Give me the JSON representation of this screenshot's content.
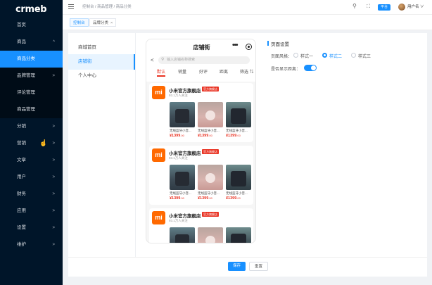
{
  "logo": "crmeb",
  "sidebar": {
    "items": [
      {
        "label": "首页",
        "arrow": ""
      },
      {
        "label": "商品",
        "arrow": "^"
      },
      {
        "label": "商品分类",
        "arrow": ""
      },
      {
        "label": "品牌管理",
        "arrow": ">"
      },
      {
        "label": "评论管理",
        "arrow": ""
      },
      {
        "label": "商品管理",
        "arrow": ""
      },
      {
        "label": "分销",
        "arrow": ">"
      },
      {
        "label": "营销",
        "arrow": ">"
      },
      {
        "label": "文章",
        "arrow": ">"
      },
      {
        "label": "用户",
        "arrow": ">"
      },
      {
        "label": "财务",
        "arrow": ">"
      },
      {
        "label": "应用",
        "arrow": ">"
      },
      {
        "label": "设置",
        "arrow": ">"
      },
      {
        "label": "维护",
        "arrow": ">"
      }
    ]
  },
  "header": {
    "breadcrumb": "控制台 / 商品管理 / 商品分类",
    "badge": "平台",
    "username": "用户名",
    "caret": "∨"
  },
  "tabs": [
    {
      "label": "控制台"
    },
    {
      "label": "品牌分类",
      "close": "×"
    }
  ],
  "page_menu": [
    {
      "label": "商城首页"
    },
    {
      "label": "店铺街"
    },
    {
      "label": "个人中心"
    }
  ],
  "phone": {
    "title": "店铺街",
    "menu_dots": "•••",
    "search_placeholder": "输入店铺名称搜索",
    "back": "<",
    "filters": [
      "默认",
      "销量",
      "好评",
      "距离",
      "筛选 ⇅"
    ],
    "stores": [
      {
        "logo": "mi",
        "name": "小米官方旗舰店",
        "badge": "官方旗舰店",
        "fans": "93.1万人关注",
        "products": [
          {
            "name": "无线蓝牙小音...",
            "price": "¥1399",
            "decimal": ".00"
          },
          {
            "name": "无线蓝牙小音...",
            "price": "¥1399",
            "decimal": ".00"
          },
          {
            "name": "无线蓝牙小音...",
            "price": "¥1399",
            "decimal": ".00"
          }
        ]
      },
      {
        "logo": "mi",
        "name": "小米官方旗舰店",
        "badge": "官方旗舰店",
        "fans": "93.1万人关注",
        "products": [
          {
            "name": "无线蓝牙小音...",
            "price": "¥1399",
            "decimal": ".00"
          },
          {
            "name": "无线蓝牙小音...",
            "price": "¥1399",
            "decimal": ".00"
          },
          {
            "name": "无线蓝牙小音...",
            "price": "¥1399",
            "decimal": ".00"
          }
        ]
      },
      {
        "logo": "mi",
        "name": "小米官方旗舰店",
        "badge": "官方旗舰店",
        "fans": "93.1万人关注",
        "products": [
          {
            "name": "",
            "price": "",
            "decimal": ""
          },
          {
            "name": "",
            "price": "",
            "decimal": ""
          },
          {
            "name": "",
            "price": "",
            "decimal": ""
          }
        ]
      }
    ]
  },
  "settings": {
    "title": "页面设置",
    "style_label": "页面风格：",
    "styles": [
      "样式一",
      "样式二",
      "样式三"
    ],
    "selected_style": "样式二",
    "distance_label": "是否显示距离：",
    "distance_on": true
  },
  "footer": {
    "save": "保存",
    "reset": "重置"
  },
  "colors": {
    "accent": "#1890ff",
    "sidebar": "#001529",
    "price": "#e93323",
    "brand_logo": "#ff6900"
  }
}
